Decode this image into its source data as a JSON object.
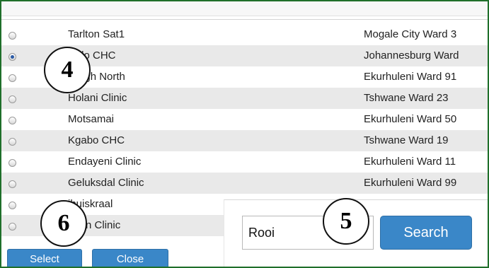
{
  "table": {
    "rows": [
      {
        "name": "Tarlton Sat1",
        "ward": "Mogale City Ward 3",
        "selected": false
      },
      {
        "name": "welo CHC",
        "ward": "Johannesburg Ward",
        "selected": true
      },
      {
        "name": "nleigh North",
        "ward": "Ekurhuleni Ward 91",
        "selected": false
      },
      {
        "name": "Holani Clinic",
        "ward": "Tshwane Ward 23",
        "selected": false
      },
      {
        "name": "Motsamai",
        "ward": "Ekurhuleni Ward 50",
        "selected": false
      },
      {
        "name": "Kgabo CHC",
        "ward": "Tshwane Ward 19",
        "selected": false
      },
      {
        "name": "Endayeni Clinic",
        "ward": "Ekurhuleni Ward 11",
        "selected": false
      },
      {
        "name": "Geluksdal Clinic",
        "ward": "Ekurhuleni Ward 99",
        "selected": false
      },
      {
        "name": "ihuiskraal",
        "ward": "",
        "selected": false
      },
      {
        "name": "ndon Clinic",
        "ward": "",
        "selected": false
      }
    ]
  },
  "callouts": [
    "4",
    "5",
    "6"
  ],
  "search": {
    "value": "Rooi",
    "button_label": "Search"
  },
  "buttons": {
    "select_label": "Select",
    "close_label": "Close"
  },
  "colors": {
    "border": "#1f6f2a",
    "button": "#3a87c8",
    "row_alt": "#e9e9e9"
  }
}
